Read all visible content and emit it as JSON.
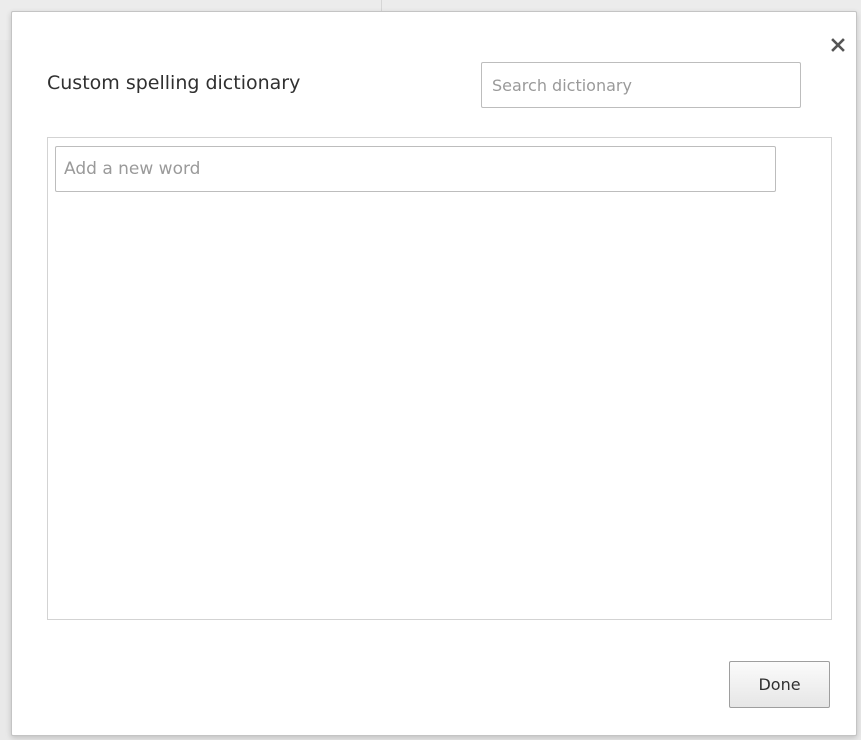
{
  "dialog": {
    "title": "Custom spelling dictionary",
    "search": {
      "placeholder": "Search dictionary",
      "value": ""
    },
    "new_word": {
      "placeholder": "Add a new word",
      "value": ""
    },
    "words": [],
    "done_label": "Done",
    "close_icon": "close-icon"
  },
  "colors": {
    "backdrop": "#e9e9e9",
    "dialog_background": "#ffffff",
    "border": "#bdbdbd",
    "text": "#303030",
    "placeholder": "#9a9a9a"
  }
}
